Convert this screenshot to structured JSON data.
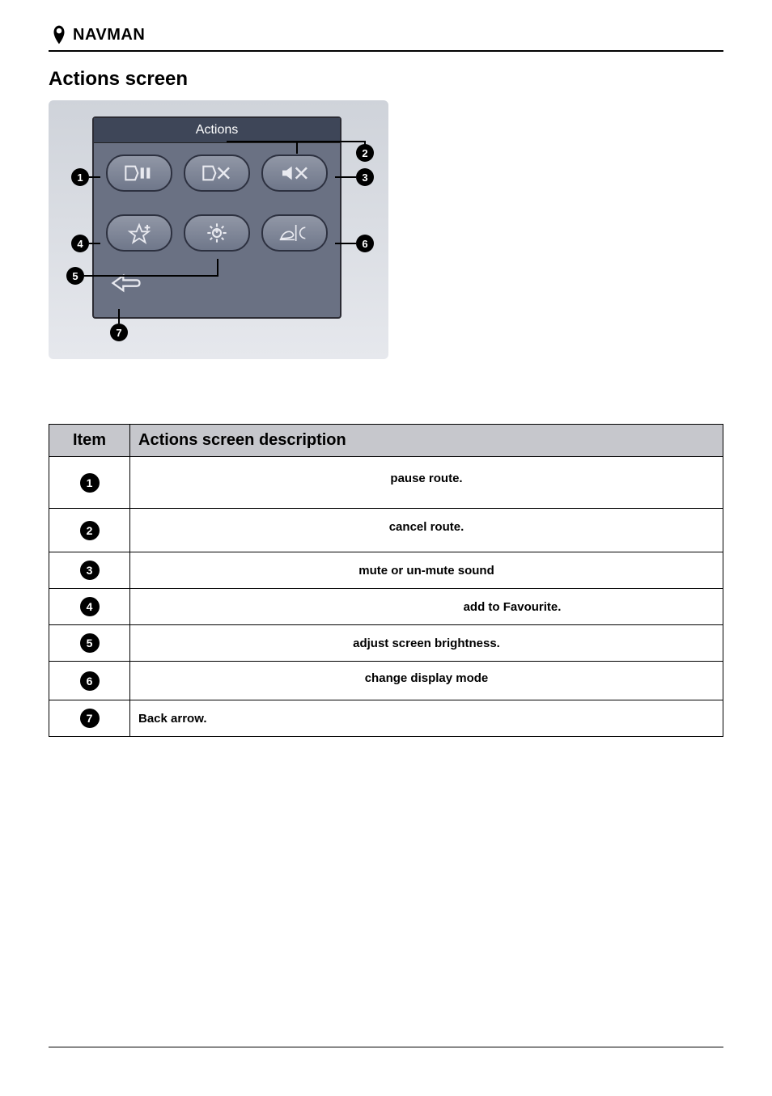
{
  "header": {
    "brand": "NAVMAN"
  },
  "section_title": "Actions screen",
  "device": {
    "title": "Actions"
  },
  "callouts": [
    "1",
    "2",
    "3",
    "4",
    "5",
    "6",
    "7"
  ],
  "table": {
    "headers": {
      "item": "Item",
      "desc": "Actions screen description"
    },
    "rows": [
      {
        "num": "1",
        "desc": "pause route."
      },
      {
        "num": "2",
        "desc": "cancel route."
      },
      {
        "num": "3",
        "desc": "mute or un-mute sound"
      },
      {
        "num": "4",
        "desc": "add to Favourite."
      },
      {
        "num": "5",
        "desc": "adjust screen brightness."
      },
      {
        "num": "6",
        "desc": "change display mode"
      },
      {
        "num": "7",
        "desc": "Back arrow."
      }
    ]
  }
}
